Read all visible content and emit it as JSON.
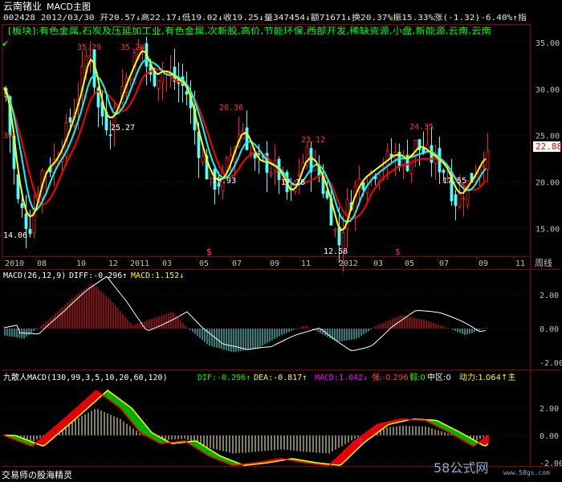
{
  "colors": {
    "background": "#000000",
    "frame": "#8B0000",
    "up": "#FF2020",
    "down": "#54FCFC",
    "ma_white": "#FFFFFF",
    "ma_yellow": "#FFFF00",
    "ma_red": "#FF0000",
    "ma_cyan": "#00FFFF",
    "axis_text": "#C0C0C0",
    "green": "#00C800",
    "magenta": "#FF00FF"
  },
  "header": {
    "stock_name": "云南锗业",
    "chart_mode": "MACD主图",
    "info": "002428 2012/03/30 开20.57↓高22.17↓低19.02↓收19.25↓量347454↓额71671↓换20.37%振15.33%涨(-1.32)-6.40%↑指",
    "sectors": "[板块]:有色金属,石炭及压延加工业,有色金属,次新股,高价,节能环保,西部开发,稀缺资源,小盘,新能源,云南,云南",
    "check_mark": "✔"
  },
  "main_panel": {
    "y_ticks": [
      "35.00",
      "30.00",
      "25.00",
      "20.00",
      "15.00"
    ],
    "current_price": "22.88",
    "x_labels": [
      "2010",
      "08",
      "10",
      "12",
      "2011",
      "03",
      "05",
      "07",
      "09",
      "11",
      "2012",
      "03",
      "05",
      "07",
      "09",
      "11"
    ],
    "period_label": "周线",
    "price_labels": [
      "30",
      "35.29",
      "35.20",
      "25.27",
      "14.06",
      "26.36",
      "19.93",
      "23.12",
      "17.18",
      "12.58",
      "24.35",
      "17.55"
    ],
    "markers": [
      "$",
      "$",
      "$"
    ]
  },
  "macd_panel": {
    "title": "MACD(26,12,9)",
    "diff": "DIFF:-0.296↑",
    "macd": "MACD:1.152↓",
    "y_ticks": [
      "2.00",
      "0.00",
      "-2.00"
    ]
  },
  "jiusanren_panel": {
    "title": "九散人MACD(130,99,3,5,10,20,60,120)",
    "dif": "DIF:-0.296↑",
    "dea": "DEA:-0.817↑",
    "macd": "MACD:1.042↓",
    "strong": "强:-0.296↑",
    "weak": "弱:0",
    "zhongqu": "中区:0",
    "dongli": "动力:1.064↑主",
    "y_ticks": [
      "2.00",
      "0.00",
      "-2.00"
    ],
    "marker": "-2",
    "footer_left": "交易师の股海精灵",
    "watermark": "58公式网",
    "watermark_url": "www.58gs.com"
  },
  "chart_data": {
    "type": "candlestick",
    "title": "云南锗业 MACD主图",
    "period": "周线",
    "ylim": [
      12,
      37
    ],
    "x_ticks": [
      "2010",
      "08",
      "10",
      "12",
      "2011",
      "03",
      "05",
      "07",
      "09",
      "11",
      "2012",
      "03",
      "05",
      "07",
      "09",
      "11"
    ],
    "last_bar": {
      "date": "2012/03/30",
      "open": 20.57,
      "high": 22.17,
      "low": 19.02,
      "close": 19.25,
      "volume": 347454,
      "amount": 71671,
      "turnover_pct": 20.37,
      "amplitude_pct": 15.33,
      "change": -1.32,
      "change_pct": -6.4
    },
    "current_price": 22.88,
    "annotated_highs": [
      30,
      35.29,
      35.2,
      26.36,
      23.12,
      24.35
    ],
    "annotated_lows": [
      25.27,
      14.06,
      19.93,
      17.18,
      12.58,
      17.55
    ],
    "macd": {
      "params": [
        26,
        12,
        9
      ],
      "diff": -0.296,
      "macd": 1.152,
      "ylim": [
        -3,
        3
      ]
    },
    "jiusanren_macd": {
      "params": [
        130,
        99,
        3,
        5,
        10,
        20,
        60,
        120
      ],
      "dif": -0.296,
      "dea": -0.817,
      "macd": 1.042,
      "strong": -0.296,
      "weak": 0,
      "zhongqu": 0,
      "dongli": 1.064
    }
  }
}
